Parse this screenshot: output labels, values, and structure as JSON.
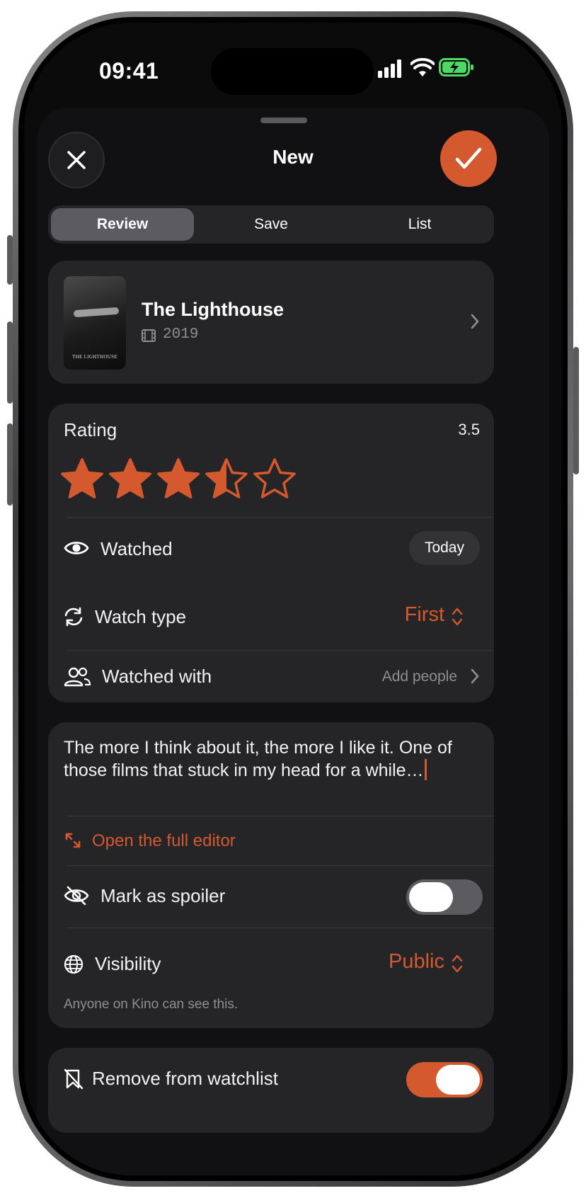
{
  "status_bar": {
    "time": "09:41"
  },
  "header": {
    "title": "New"
  },
  "tabs": [
    {
      "label": "Review",
      "selected": true
    },
    {
      "label": "Save",
      "selected": false
    },
    {
      "label": "List",
      "selected": false
    }
  ],
  "film": {
    "title": "The Lighthouse",
    "year": "2019",
    "poster_text": "THE LIGHTHOUSE"
  },
  "rating": {
    "label": "Rating",
    "value": "3.5",
    "stars": 3.5,
    "max": 5
  },
  "watched": {
    "label": "Watched",
    "date": "Today"
  },
  "watch_type": {
    "label": "Watch type",
    "value": "First"
  },
  "watched_with": {
    "label": "Watched with",
    "placeholder": "Add people"
  },
  "review": {
    "text": "The more I think about it, the more I like it. One of those films that stuck in my head for a while…",
    "open_editor": "Open the full editor"
  },
  "spoiler": {
    "label": "Mark as spoiler",
    "on": false
  },
  "visibility": {
    "label": "Visibility",
    "value": "Public",
    "note": "Anyone on Kino can see this."
  },
  "watchlist": {
    "label": "Remove from watchlist",
    "on": true
  },
  "colors": {
    "accent": "#d4592f",
    "card": "#252528",
    "background": "#111113",
    "battery": "#4cd964"
  }
}
